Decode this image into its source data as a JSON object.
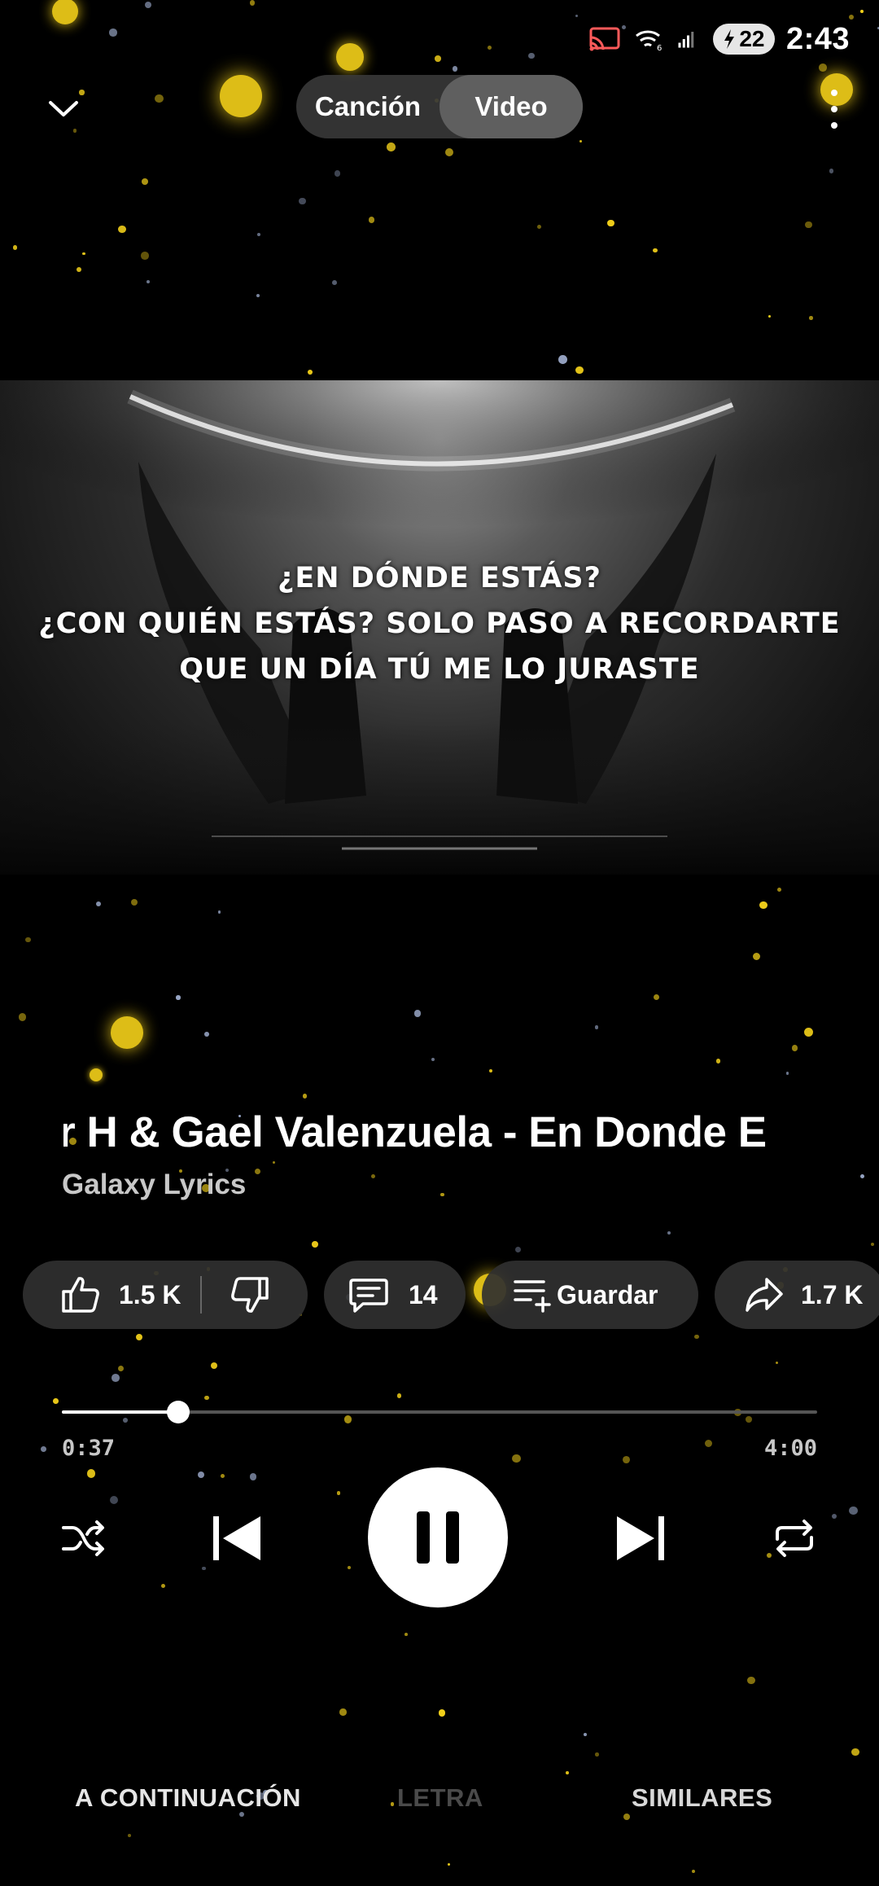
{
  "status_bar": {
    "battery_level": "22",
    "time": "2:43",
    "icons": [
      "cast-icon",
      "wifi-icon",
      "signal-icon",
      "battery-charging-icon"
    ]
  },
  "header": {
    "tabs": [
      {
        "label": "Canción",
        "active": false
      },
      {
        "label": "Video",
        "active": true
      }
    ]
  },
  "video": {
    "lyrics": [
      "¿EN DÓNDE ESTÁS?",
      "¿CON QUIÉN ESTÁS? SOLO PASO A RECORDARTE",
      "QUE UN DÍA TÚ ME LO JURASTE"
    ]
  },
  "song": {
    "title": "ior H & Gael Valenzuela - En Donde E",
    "artist": "Galaxy Lyrics"
  },
  "actions": {
    "likes": "1.5 K",
    "comments": "14",
    "save_label": "Guardar",
    "shares": "1.7 K"
  },
  "player": {
    "current_time": "0:37",
    "total_time": "4:00",
    "progress": 0.154,
    "state": "playing"
  },
  "bottom_tabs": {
    "up_next": "A CONTINUACIÓN",
    "lyrics": "LETRA",
    "related": "SIMILARES"
  },
  "colors": {
    "background": "#000000",
    "chip": "#303030",
    "particle": "#f5d21a",
    "muted_text": "#c8c8c8",
    "disabled_tab": "#4a4a4a"
  }
}
